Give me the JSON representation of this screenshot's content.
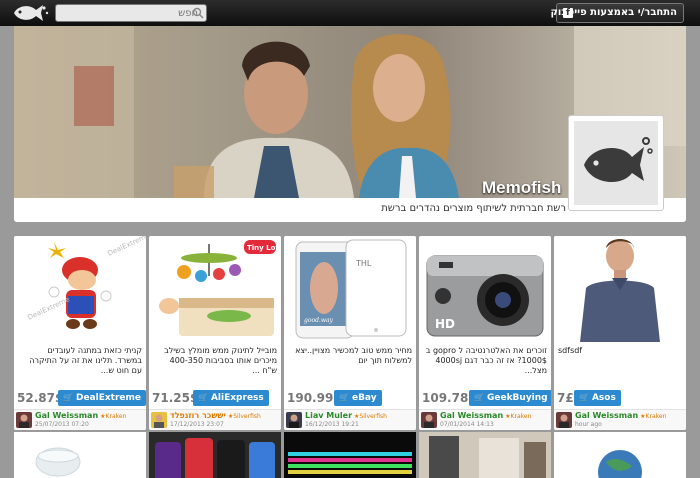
{
  "header": {
    "search_placeholder": "חפש",
    "facebook_button": "התחבר/י באמצעות פייסבוק",
    "facebook_icon": "f"
  },
  "cover": {
    "brand_name": "Memofish",
    "tagline": "רשת חברתית לשיתוף מוצרים נהדרים ברשת"
  },
  "products": [
    {
      "description": "קניתי כזאת במתנה לעובדים במשרד. תלינו את זה על התיקרה עם חוט ש...",
      "price": "52.87$",
      "store": "DealExtreme",
      "user": "Gal Weissman",
      "rank": "Kraken",
      "date": "25/07/2013 07:20",
      "watermark": "DealExtreme"
    },
    {
      "description": "מובייל לתינוק ממש מומלץ בשילב מיכרים אותו בסביבות 400-350 ש\"ח ...",
      "price": "71.25$",
      "store": "AliExpress",
      "user": "יששכר רוזנפלד",
      "rank": "Silverfish",
      "date": "17/12/2013 23:07",
      "badge": "Tiny Love"
    },
    {
      "description": "מחיר ממש טוב למכשיר מצויין..יצא למשלוח תוך יום",
      "price": "190.99$",
      "store": "eBay",
      "user": "Liav Muler",
      "rank": "Silverfish",
      "date": "16/12/2013 19:21",
      "phone_text": "good.way",
      "phone_brand": "THL"
    },
    {
      "description": "זוכרים את האלטרנטיבה ל gopro ב 1000$? אז זה כבר דגם 4000sj מצל...",
      "price": "109.78$",
      "store": "GeekBuying",
      "user": "Gal Weissman",
      "rank": "Kraken",
      "date": "07/01/2014 14:13",
      "camera_label": "HD"
    },
    {
      "description": "sdfsdf",
      "price": "7£",
      "store": "Asos",
      "user": "Gal Weissman",
      "rank": "Kraken",
      "date": "hour ago"
    }
  ],
  "colors": {
    "background": "#9a9a9a",
    "store_button": "#2c8ad0",
    "username": "#2b8a2b",
    "rank": "#e07a00"
  },
  "icons": [
    "memofish-logo-icon",
    "search-icon",
    "facebook-icon",
    "shopping-cart-icon",
    "star-icon"
  ]
}
